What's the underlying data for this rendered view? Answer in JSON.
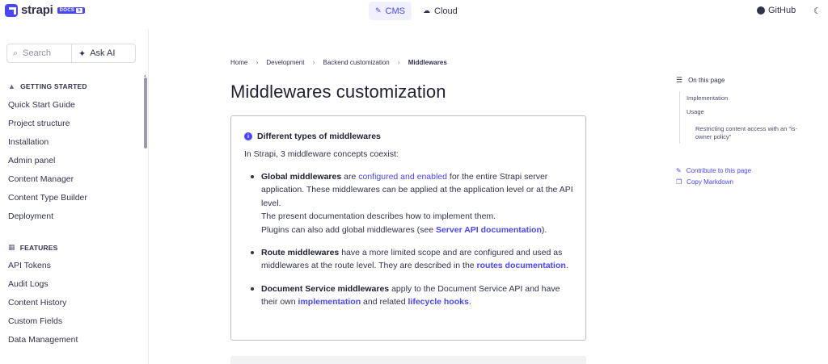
{
  "brand": {
    "name": "strapi",
    "badge": "DOCS",
    "version": "5"
  },
  "topnav": {
    "tabs": [
      {
        "label": "CMS",
        "active": true
      },
      {
        "label": "Cloud",
        "active": false
      }
    ],
    "github_label": "GitHub"
  },
  "sidebar": {
    "search_placeholder": "Search",
    "ask_ai_label": "Ask AI",
    "sections": [
      {
        "title": "GETTING STARTED",
        "items": [
          "Quick Start Guide",
          "Project structure",
          "Installation",
          "Admin panel",
          "Content Manager",
          "Content Type Builder",
          "Deployment"
        ]
      },
      {
        "title": "FEATURES",
        "items": [
          "API Tokens",
          "Audit Logs",
          "Content History",
          "Custom Fields",
          "Data Management"
        ]
      }
    ]
  },
  "breadcrumb": [
    "Home",
    "Development",
    "Backend customization",
    "Middlewares"
  ],
  "page": {
    "title": "Middlewares customization",
    "note": {
      "title": "Different types of middlewares",
      "intro": "In Strapi, 3 middleware concepts coexist:",
      "global": {
        "term": "Global middlewares",
        "t1": " are ",
        "link1": "configured and enabled",
        "t2": " for the entire Strapi server application. These middlewares can be applied at the application level or at the API level.",
        "line2": "The present documentation describes how to implement them.",
        "line3a": "Plugins can also add global middlewares (see ",
        "link2": "Server API documentation",
        "line3b": ")."
      },
      "route": {
        "term": "Route middlewares",
        "t1": " have a more limited scope and are configured and used as middlewares at the route level. They are described in the ",
        "link": "routes documentation",
        "t2": "."
      },
      "document": {
        "term": "Document Service middlewares",
        "t1": " apply to the Document Service API and have their own ",
        "link1": "implementation",
        "t2": " and related ",
        "link2": "lifecycle hooks",
        "t3": "."
      }
    }
  },
  "toc": {
    "title": "On this page",
    "items": [
      "Implementation",
      "Usage"
    ],
    "subitem_line1": "Restricting content access with an \"is-",
    "subitem_line2": "owner policy\"",
    "contribute_label": "Contribute to this page",
    "copy_label": "Copy Markdown"
  },
  "colors": {
    "accent": "#4945ff",
    "text": "#32324d",
    "border": "#dcdce4"
  }
}
